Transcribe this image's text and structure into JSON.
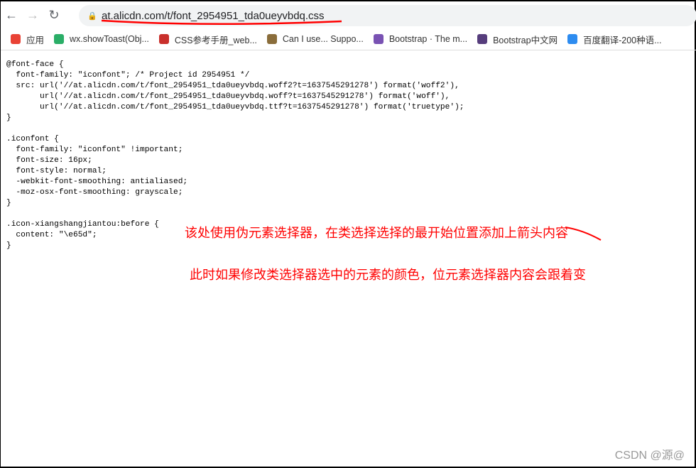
{
  "browser": {
    "url": "at.alicdn.com/t/font_2954951_tda0ueyvbdq.css"
  },
  "bookmarks": [
    {
      "label": "应用",
      "color": "#e94235",
      "icon": "apps-grid-icon"
    },
    {
      "label": "wx.showToast(Obj...",
      "color": "#2aae67",
      "icon": "wechat-icon"
    },
    {
      "label": "CSS参考手册_web...",
      "color": "#c9302c",
      "icon": "d-logo-icon"
    },
    {
      "label": "Can I use... Suppo...",
      "color": "#8a6d3b",
      "icon": "caniuse-icon"
    },
    {
      "label": "Bootstrap · The m...",
      "color": "#7952b3",
      "icon": "bootstrap-icon"
    },
    {
      "label": "Bootstrap中文网",
      "color": "#563d7c",
      "icon": "bootstrap-icon"
    },
    {
      "label": "百度翻译-200种语...",
      "color": "#2d8cf0",
      "icon": "translate-icon"
    }
  ],
  "code": "@font-face {\n  font-family: \"iconfont\"; /* Project id 2954951 */\n  src: url('//at.alicdn.com/t/font_2954951_tda0ueyvbdq.woff2?t=1637545291278') format('woff2'),\n       url('//at.alicdn.com/t/font_2954951_tda0ueyvbdq.woff?t=1637545291278') format('woff'),\n       url('//at.alicdn.com/t/font_2954951_tda0ueyvbdq.ttf?t=1637545291278') format('truetype');\n}\n\n.iconfont {\n  font-family: \"iconfont\" !important;\n  font-size: 16px;\n  font-style: normal;\n  -webkit-font-smoothing: antialiased;\n  -moz-osx-font-smoothing: grayscale;\n}\n\n.icon-xiangshangjiantou:before {\n  content: \"\\e65d\";\n}",
  "annotations": {
    "note1": "该处使用伪元素选择器，在类选择选择的最开始位置添加上箭头内容",
    "note2": "此时如果修改类选择器选中的元素的颜色，位元素选择器内容会跟着变",
    "color": "#ff0000"
  },
  "watermark": "CSDN @源@"
}
